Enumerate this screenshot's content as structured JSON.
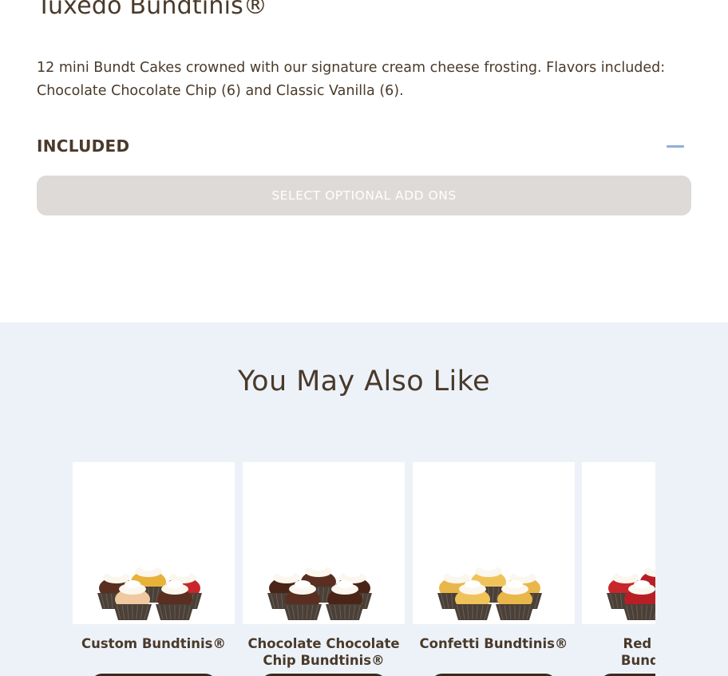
{
  "product": {
    "title": "Tuxedo Bundtinis®",
    "description": "12 mini Bundt Cakes crowned with our signature cream cheese frosting. Flavors included: Chocolate Chocolate Chip (6) and Classic Vanilla (6).",
    "included_label": "INCLUDED",
    "collapse_icon": "minus-icon",
    "addons_button": "SELECT OPTIONAL ADD ONS"
  },
  "also_like": {
    "title": "You May Also Like",
    "items": [
      {
        "name": "Custom Bundtinis®",
        "colors": [
          "#5a2e20",
          "#e8b23a",
          "#c8262b",
          "#f0c9a0"
        ]
      },
      {
        "name": "Chocolate Chocolate Chip Bundtinis®",
        "colors": [
          "#4b2418",
          "#5a2e20",
          "#4b2418",
          "#5a2e20"
        ]
      },
      {
        "name": "Confetti Bundtinis®",
        "colors": [
          "#e9b64a",
          "#f0c35a",
          "#e9b64a",
          "#f0c35a"
        ]
      },
      {
        "name": "Red Velvet Bundtinis®",
        "colors": [
          "#c8262b",
          "#b81f25",
          "#c8262b",
          "#b81f25"
        ]
      }
    ]
  },
  "colors": {
    "text": "#4a3a2a",
    "accent": "#8fb0d6",
    "button_disabled": "#dedad8",
    "section_bg": "#edf2f9"
  }
}
